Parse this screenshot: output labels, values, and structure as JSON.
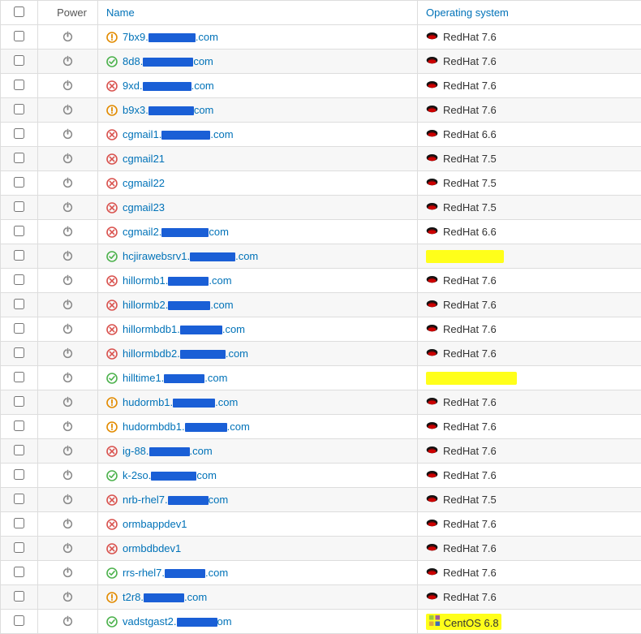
{
  "headers": {
    "power": "Power",
    "name": "Name",
    "os": "Operating system"
  },
  "colors": {
    "link": "#0072b8",
    "error": "#d9534f",
    "ok": "#4db24d",
    "warn": "#e28b00",
    "redact": "#1a5fd6",
    "highlight": "#ffff1a",
    "redhat": "#cc0000"
  },
  "rows": [
    {
      "status": "warn",
      "name_pre": "7bx9.",
      "name_redact_w": 58,
      "name_post": ".com",
      "os_type": "redhat",
      "os_text": "RedHat 7.6"
    },
    {
      "status": "ok",
      "name_pre": "8d8.",
      "name_redact_w": 62,
      "name_post": "com",
      "os_type": "redhat",
      "os_text": "RedHat 7.6"
    },
    {
      "status": "error",
      "name_pre": "9xd.",
      "name_redact_w": 60,
      "name_post": ".com",
      "os_type": "redhat",
      "os_text": "RedHat 7.6"
    },
    {
      "status": "warn",
      "name_pre": "b9x3.",
      "name_redact_w": 56,
      "name_post": "com",
      "os_type": "redhat",
      "os_text": "RedHat 7.6"
    },
    {
      "status": "error",
      "name_pre": "cgmail1.",
      "name_redact_w": 60,
      "name_post": ".com",
      "os_type": "redhat",
      "os_text": "RedHat 6.6"
    },
    {
      "status": "error",
      "name_pre": "cgmail21",
      "name_redact_w": 0,
      "name_post": "",
      "os_type": "redhat",
      "os_text": "RedHat 7.5"
    },
    {
      "status": "error",
      "name_pre": "cgmail22",
      "name_redact_w": 0,
      "name_post": "",
      "os_type": "redhat",
      "os_text": "RedHat 7.5"
    },
    {
      "status": "error",
      "name_pre": "cgmail23",
      "name_redact_w": 0,
      "name_post": "",
      "os_type": "redhat",
      "os_text": "RedHat 7.5"
    },
    {
      "status": "error",
      "name_pre": "cgmail2.",
      "name_redact_w": 58,
      "name_post": "com",
      "os_type": "redhat",
      "os_text": "RedHat 6.6"
    },
    {
      "status": "ok",
      "name_pre": "hcjirawebsrv1.",
      "name_redact_w": 56,
      "name_post": ".com",
      "os_type": "yellow",
      "os_yellow_w": 96
    },
    {
      "status": "error",
      "name_pre": "hillormb1.",
      "name_redact_w": 50,
      "name_post": ".com",
      "os_type": "redhat",
      "os_text": "RedHat 7.6"
    },
    {
      "status": "error",
      "name_pre": "hillormb2.",
      "name_redact_w": 52,
      "name_post": ".com",
      "os_type": "redhat",
      "os_text": "RedHat 7.6"
    },
    {
      "status": "error",
      "name_pre": "hillormbdb1.",
      "name_redact_w": 52,
      "name_post": ".com",
      "os_type": "redhat",
      "os_text": "RedHat 7.6"
    },
    {
      "status": "error",
      "name_pre": "hillormbdb2.",
      "name_redact_w": 56,
      "name_post": ".com",
      "os_type": "redhat",
      "os_text": "RedHat 7.6"
    },
    {
      "status": "ok",
      "name_pre": "hilltime1.",
      "name_redact_w": 50,
      "name_post": ".com",
      "os_type": "yellow",
      "os_yellow_w": 112
    },
    {
      "status": "warn",
      "name_pre": "hudormb1.",
      "name_redact_w": 52,
      "name_post": ".com",
      "os_type": "redhat",
      "os_text": "RedHat 7.6"
    },
    {
      "status": "warn",
      "name_pre": "hudormbdb1.",
      "name_redact_w": 52,
      "name_post": ".com",
      "os_type": "redhat",
      "os_text": "RedHat 7.6"
    },
    {
      "status": "error",
      "name_pre": "ig-88.",
      "name_redact_w": 50,
      "name_post": ".com",
      "os_type": "redhat",
      "os_text": "RedHat 7.6"
    },
    {
      "status": "ok",
      "name_pre": "k-2so.",
      "name_redact_w": 56,
      "name_post": "com",
      "os_type": "redhat",
      "os_text": "RedHat 7.6"
    },
    {
      "status": "error",
      "name_pre": "nrb-rhel7.",
      "name_redact_w": 50,
      "name_post": "com",
      "os_type": "redhat",
      "os_text": "RedHat 7.5"
    },
    {
      "status": "error",
      "name_pre": "ormbappdev1",
      "name_redact_w": 0,
      "name_post": "",
      "os_type": "redhat",
      "os_text": "RedHat 7.6"
    },
    {
      "status": "error",
      "name_pre": "ormbdbdev1",
      "name_redact_w": 0,
      "name_post": "",
      "os_type": "redhat",
      "os_text": "RedHat 7.6"
    },
    {
      "status": "ok",
      "name_pre": "rrs-rhel7.",
      "name_redact_w": 50,
      "name_post": ".com",
      "os_type": "redhat",
      "os_text": "RedHat 7.6"
    },
    {
      "status": "warn",
      "name_pre": "t2r8.",
      "name_redact_w": 50,
      "name_post": ".com",
      "os_type": "redhat",
      "os_text": "RedHat 7.6"
    },
    {
      "status": "ok",
      "name_pre": "vadstgast2.",
      "name_redact_w": 50,
      "name_post": "om",
      "os_type": "centos",
      "os_text": "CentOS 6.8",
      "os_highlight": true
    }
  ]
}
